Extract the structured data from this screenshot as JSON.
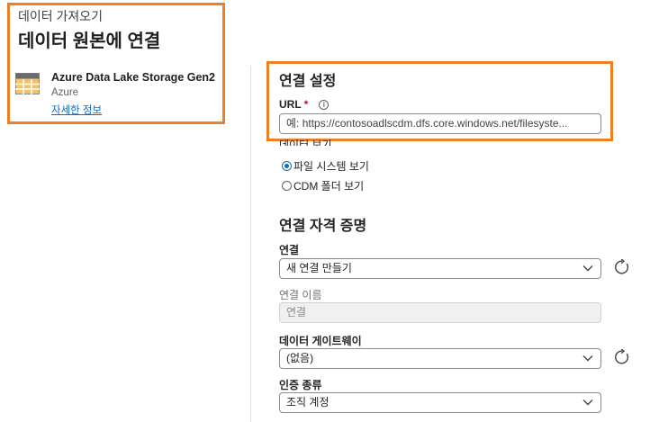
{
  "header": {
    "breadcrumb": "데이터 가져오기",
    "title": "데이터 원본에 연결"
  },
  "source": {
    "name": "Azure Data Lake Storage Gen2",
    "provider": "Azure",
    "link": "자세한 정보",
    "icon": "table-grid-icon"
  },
  "connection_settings": {
    "title": "연결 설정",
    "url_label": "URL",
    "required_mark": "*",
    "info_glyph": "i",
    "url_placeholder": "예: https://contosoadlscdm.dfs.core.windows.net/filesyste...",
    "view_label": "데이터 보기",
    "options": [
      "파일 시스템 보기",
      "CDM 폴더 보기"
    ],
    "selected_option": 0
  },
  "credentials": {
    "title": "연결 자격 증명",
    "connection_label": "연결",
    "connection_value": "새 연결 만들기",
    "connection_name_label": "연결 이름",
    "connection_name_value": "연결",
    "gateway_label": "데이터 게이트웨이",
    "gateway_value": "(없음)",
    "auth_label": "인증 종류",
    "auth_value": "조직 계정"
  },
  "colors": {
    "highlight": "#f07f22",
    "accent": "#0f6cbd",
    "required": "#c50f1f"
  }
}
